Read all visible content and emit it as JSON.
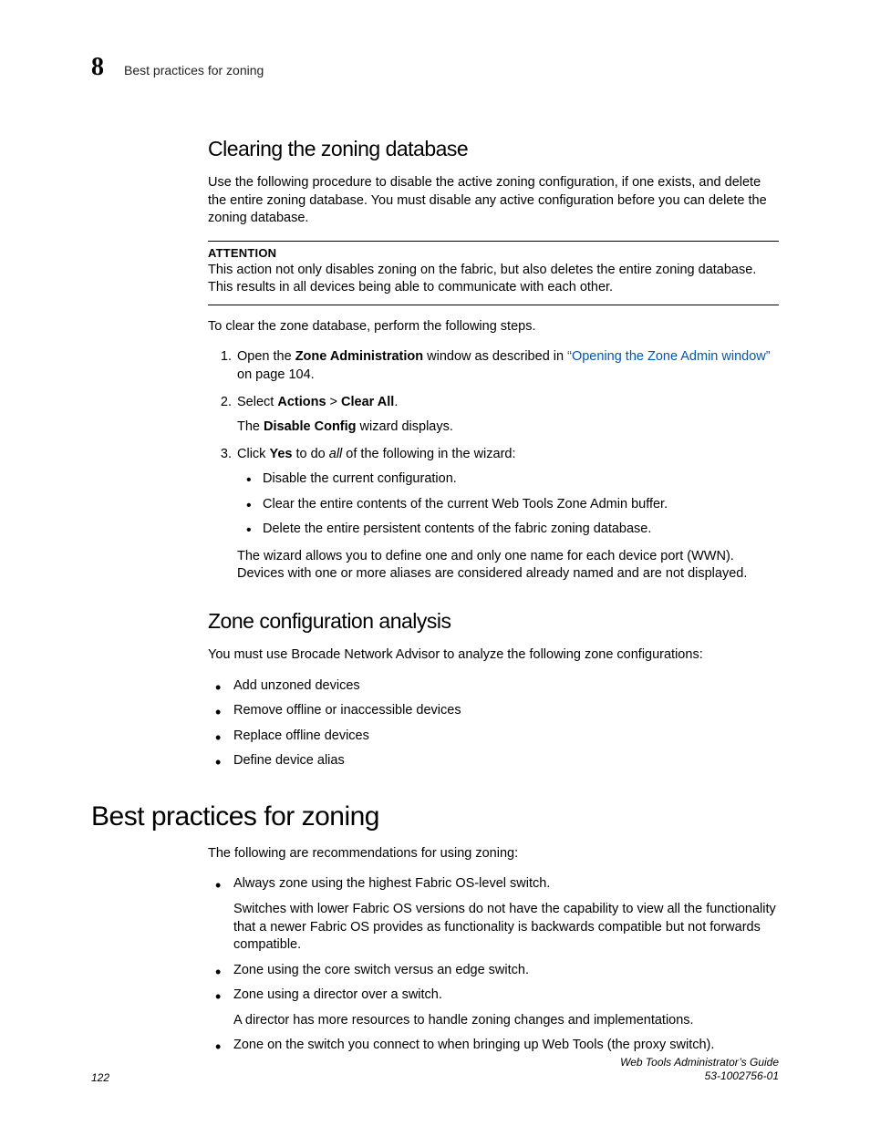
{
  "header": {
    "chapter_number": "8",
    "running_title": "Best practices for zoning"
  },
  "section1": {
    "heading": "Clearing the zoning database",
    "intro": "Use the following procedure to disable the active zoning configuration, if one exists, and delete the entire zoning database. You must disable any active configuration before you can delete the zoning database.",
    "attention_label": "ATTENTION",
    "attention_text": "This action not only disables zoning on the fabric, but also deletes the entire zoning database. This results in all devices being able to communicate with each other.",
    "lead": "To clear the zone database, perform the following steps.",
    "step1_pre": "Open the ",
    "step1_bold": "Zone Administration",
    "step1_mid": " window as described in ",
    "step1_link": "“Opening the Zone Admin window”",
    "step1_post": " on page 104.",
    "step2_pre": "Select ",
    "step2_b1": "Actions",
    "step2_gt": " > ",
    "step2_b2": "Clear All",
    "step2_post": ".",
    "step2_result_pre": "The ",
    "step2_result_bold": "Disable Config",
    "step2_result_post": " wizard displays.",
    "step3_pre": "Click ",
    "step3_bold": "Yes",
    "step3_mid": " to do ",
    "step3_italic": "all",
    "step3_post": " of the following in the wizard:",
    "step3_bullets": [
      "Disable the current configuration.",
      "Clear the entire contents of the current Web Tools Zone Admin buffer.",
      "Delete the entire persistent contents of the fabric zoning database."
    ],
    "step3_tail": "The wizard allows you to define one and only one name for each device port (WWN). Devices with one or more aliases are considered already named and are not displayed."
  },
  "section2": {
    "heading": "Zone configuration analysis",
    "intro": "You must use Brocade Network Advisor to analyze the following zone configurations:",
    "bullets": [
      "Add unzoned devices",
      "Remove offline or inaccessible devices",
      "Replace offline devices",
      "Define device alias"
    ]
  },
  "section3": {
    "heading": "Best practices for zoning",
    "intro": "The following are recommendations for using zoning:",
    "b1_main": "Always zone using the highest Fabric OS-level switch.",
    "b1_sub": "Switches with lower Fabric OS versions do not have the capability to view all the functionality that a newer Fabric OS provides as functionality is backwards compatible but not forwards compatible.",
    "b2_main": "Zone using the core switch versus an edge switch.",
    "b3_main": "Zone using a director over a switch.",
    "b3_sub": "A director has more resources to handle zoning changes and implementations.",
    "b4_main": "Zone on the switch you connect to when bringing up Web Tools (the proxy switch)."
  },
  "footer": {
    "page": "122",
    "doc_title": "Web Tools Administrator’s Guide",
    "doc_num": "53-1002756-01"
  }
}
